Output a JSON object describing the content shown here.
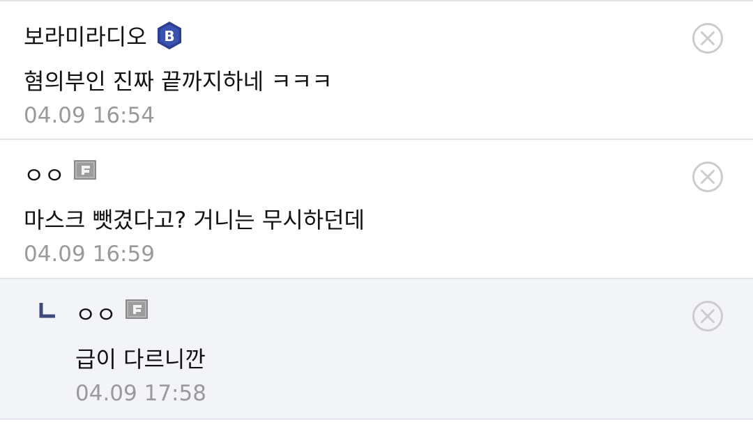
{
  "comments": [
    {
      "author": "보라미라디오",
      "badge": "B",
      "badge_icon": "b-hexagon-icon",
      "text": "혐의부인 진짜 끝까지하네 ㅋㅋㅋ",
      "time": "04.09 16:54"
    },
    {
      "author": "ㅇㅇ",
      "badge_icon": "fixed-nick-icon",
      "text": "마스크 뺏겼다고? 거니는 무시하던데",
      "time": "04.09 16:59"
    }
  ],
  "reply": {
    "author": "ㅇㅇ",
    "badge_icon": "fixed-nick-icon",
    "text": "급이 다르니깐",
    "time": "04.09 17:58"
  },
  "colors": {
    "badge_b": "#2c3e8f",
    "reply_bg": "#f3f4f8",
    "reply_arrow": "#3b4a7a",
    "delete_icon": "#cccccc",
    "timestamp": "#9a9a9a"
  }
}
